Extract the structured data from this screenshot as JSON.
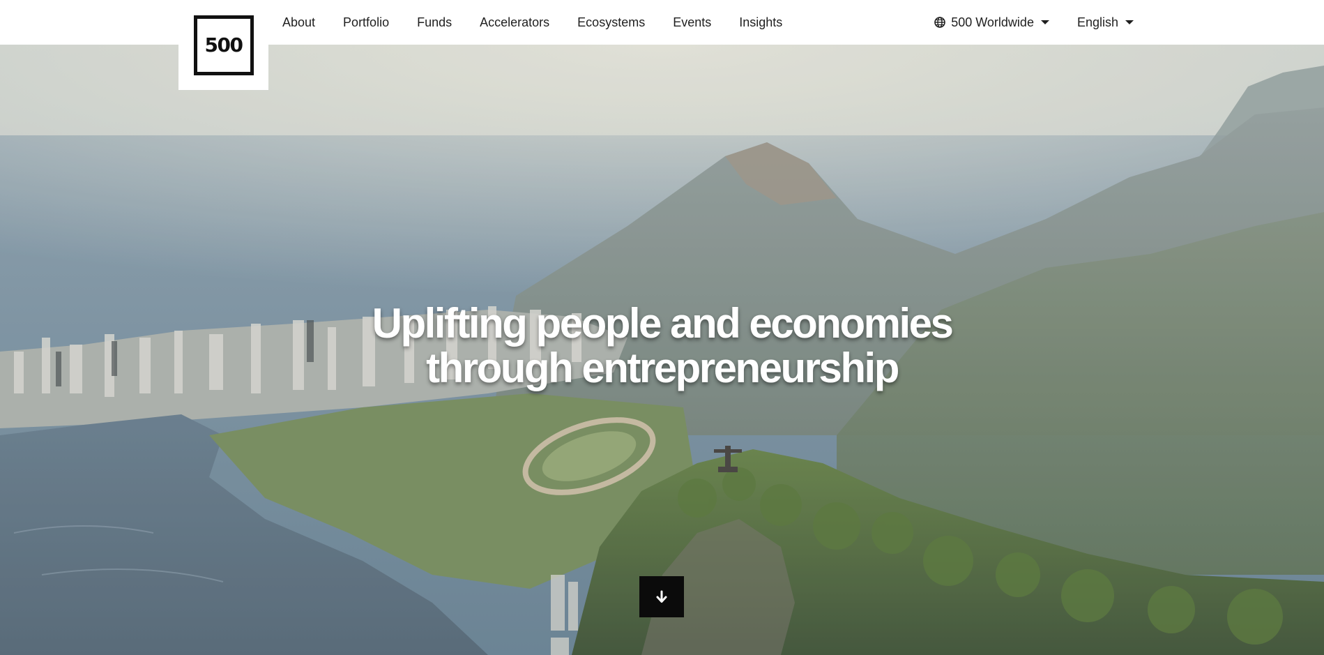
{
  "header": {
    "logo_text": "500",
    "nav": [
      {
        "label": "About"
      },
      {
        "label": "Portfolio"
      },
      {
        "label": "Funds"
      },
      {
        "label": "Accelerators"
      },
      {
        "label": "Ecosystems"
      },
      {
        "label": "Events"
      },
      {
        "label": "Insights"
      }
    ],
    "region_dropdown": {
      "label": "500 Worldwide",
      "icon": "globe-icon"
    },
    "language_dropdown": {
      "label": "English"
    }
  },
  "hero": {
    "headline_line1": "Uplifting people and economies",
    "headline_line2": "through entrepreneurship",
    "scroll_icon": "arrow-down-icon"
  }
}
